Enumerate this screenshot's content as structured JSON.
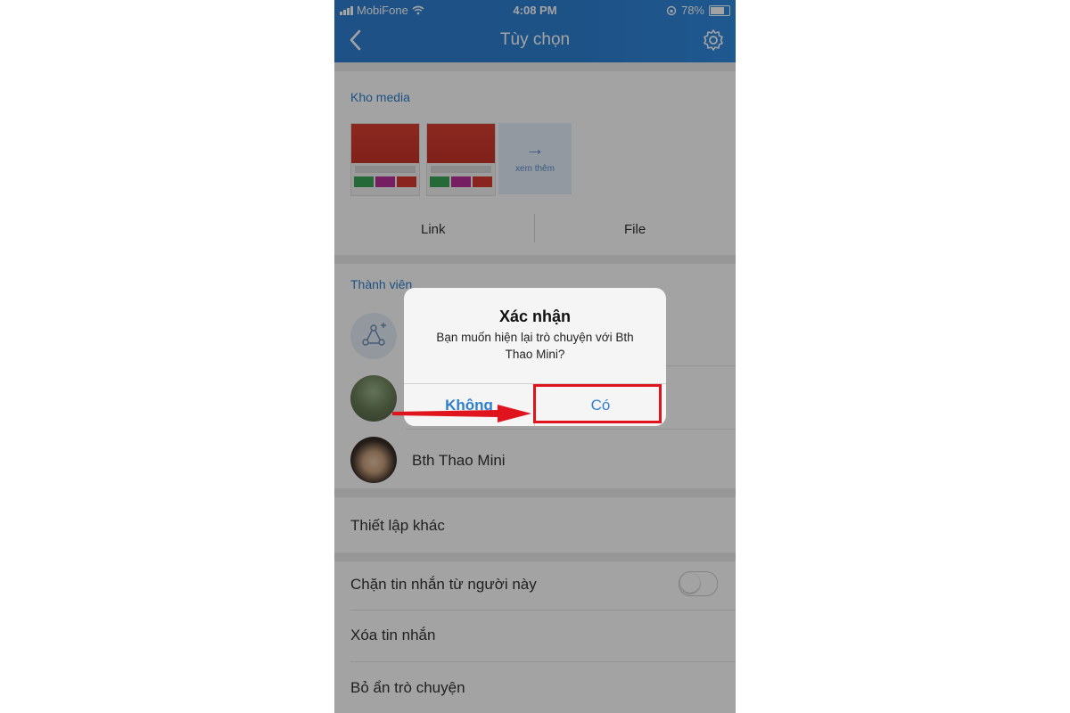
{
  "status_bar": {
    "carrier": "MobiFone",
    "time": "4:08 PM",
    "battery": "78%"
  },
  "header": {
    "title": "Tùy chọn",
    "back_icon": "chevron-left-icon",
    "settings_icon": "gear-icon"
  },
  "media": {
    "section_title": "Kho media",
    "see_more_label": "xem thêm",
    "tabs": [
      {
        "label": "Link"
      },
      {
        "label": "File"
      }
    ]
  },
  "members": {
    "section_title": "Thành viên",
    "rows": [
      {
        "name": "Bth Thao Mini"
      }
    ]
  },
  "settings": {
    "other_label": "Thiết lập khác",
    "block_label": "Chặn tin nhắn từ người này",
    "block_enabled": false,
    "delete_label": "Xóa tin nhắn",
    "unhide_label": "Bỏ ẩn trò chuyện"
  },
  "dialog": {
    "title": "Xác nhận",
    "message": "Bạn muốn hiện lại trò chuyện với Bth Thao Mini?",
    "cancel_label": "Không",
    "confirm_label": "Có"
  },
  "colors": {
    "header_blue": "#2f7fd0",
    "accent_blue": "#2f7fd0",
    "highlight_red": "#e0141c"
  }
}
